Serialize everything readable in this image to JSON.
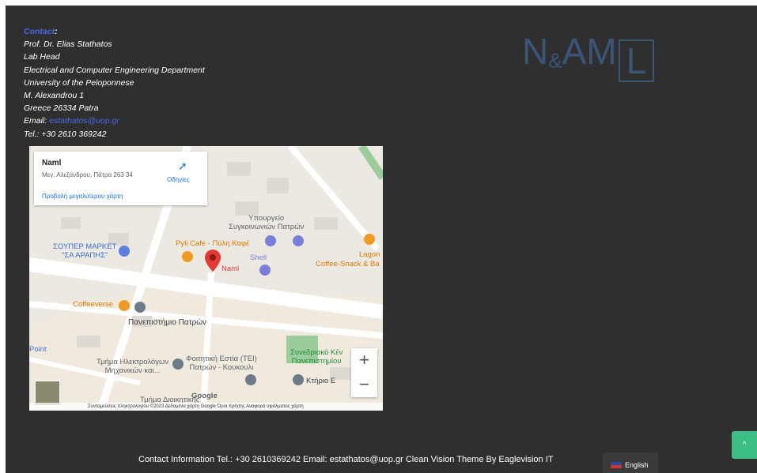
{
  "contact": {
    "heading": "Contact",
    "lines": [
      "Prof. Dr. Elias Stathatos",
      "Lab Head",
      "Electrical and Computer Engineering Department",
      "University of the Peloponnese",
      "M. Alexandrou 1",
      "Greece 26334 Patra"
    ],
    "email_label": "Email:",
    "email": "estathatos@uop.gr",
    "tel": "Tel.: +30 2610 369242"
  },
  "logo": {
    "left": "N",
    "amp": "&",
    "mid": "AM",
    "boxed": "L",
    "color": "#3a5576"
  },
  "map": {
    "card": {
      "name": "Naml",
      "address": "Μεγ. Αλεξάνδρου, Πάτρα 263 34",
      "directions": "Οδηγίες",
      "larger_map": "Προβολή μεγαλύτερου χάρτη"
    },
    "labels": {
      "ministry": "Υπουργείο\nΣυγκοινωνιών Πατρών",
      "pyli": "Pyli Cafe - Πύλη Καφέ",
      "supermarket": "ΣΟΥΠΕΡ ΜΑΡΚΕΤ\n\"ΣΑ ΑΡΑΠΗΣ\"",
      "shell": "Shell",
      "lagon": "Lagon",
      "coffee_snack": "Coffee-Snack & Ba",
      "naml": "Naml",
      "coffeeverse": "Coffeeverse",
      "university": "Πανεπιστήμιο Πατρών",
      "dept": "Τμήμα Ηλεκτρολόγων\nΜηχανικών και...",
      "residence": "Φοιτητική Εστία (ΤΕΙ)\nΠατρών - Κουκουλι",
      "conference": "Συνεδριακό Κέν\nΠανεπιστημίου",
      "ktirio": "Κτήριο Ε",
      "point": "Point",
      "mgmt": "Τμήμα Διοικητικής",
      "google": "Google"
    },
    "attribution": "Συντομεύσεις πληκτρολογίου   ©2023 Δεδομένα χάρτη Google   Όροι Χρήσης   Αναφορά σφάλματος χάρτη",
    "zoom_in": "+",
    "zoom_out": "−"
  },
  "footer": {
    "text": "Contact Information Tel.: +30 2610369242 Email: estathatos@uop.gr  Clean Vision Theme By Eaglevision IT"
  },
  "language": {
    "label": "English"
  },
  "back_to_top": "^",
  "colors": {
    "background": "#2f2f2f",
    "accent": "#4a66e8",
    "top_button": "#3bbf86",
    "pin": "#e53935"
  }
}
